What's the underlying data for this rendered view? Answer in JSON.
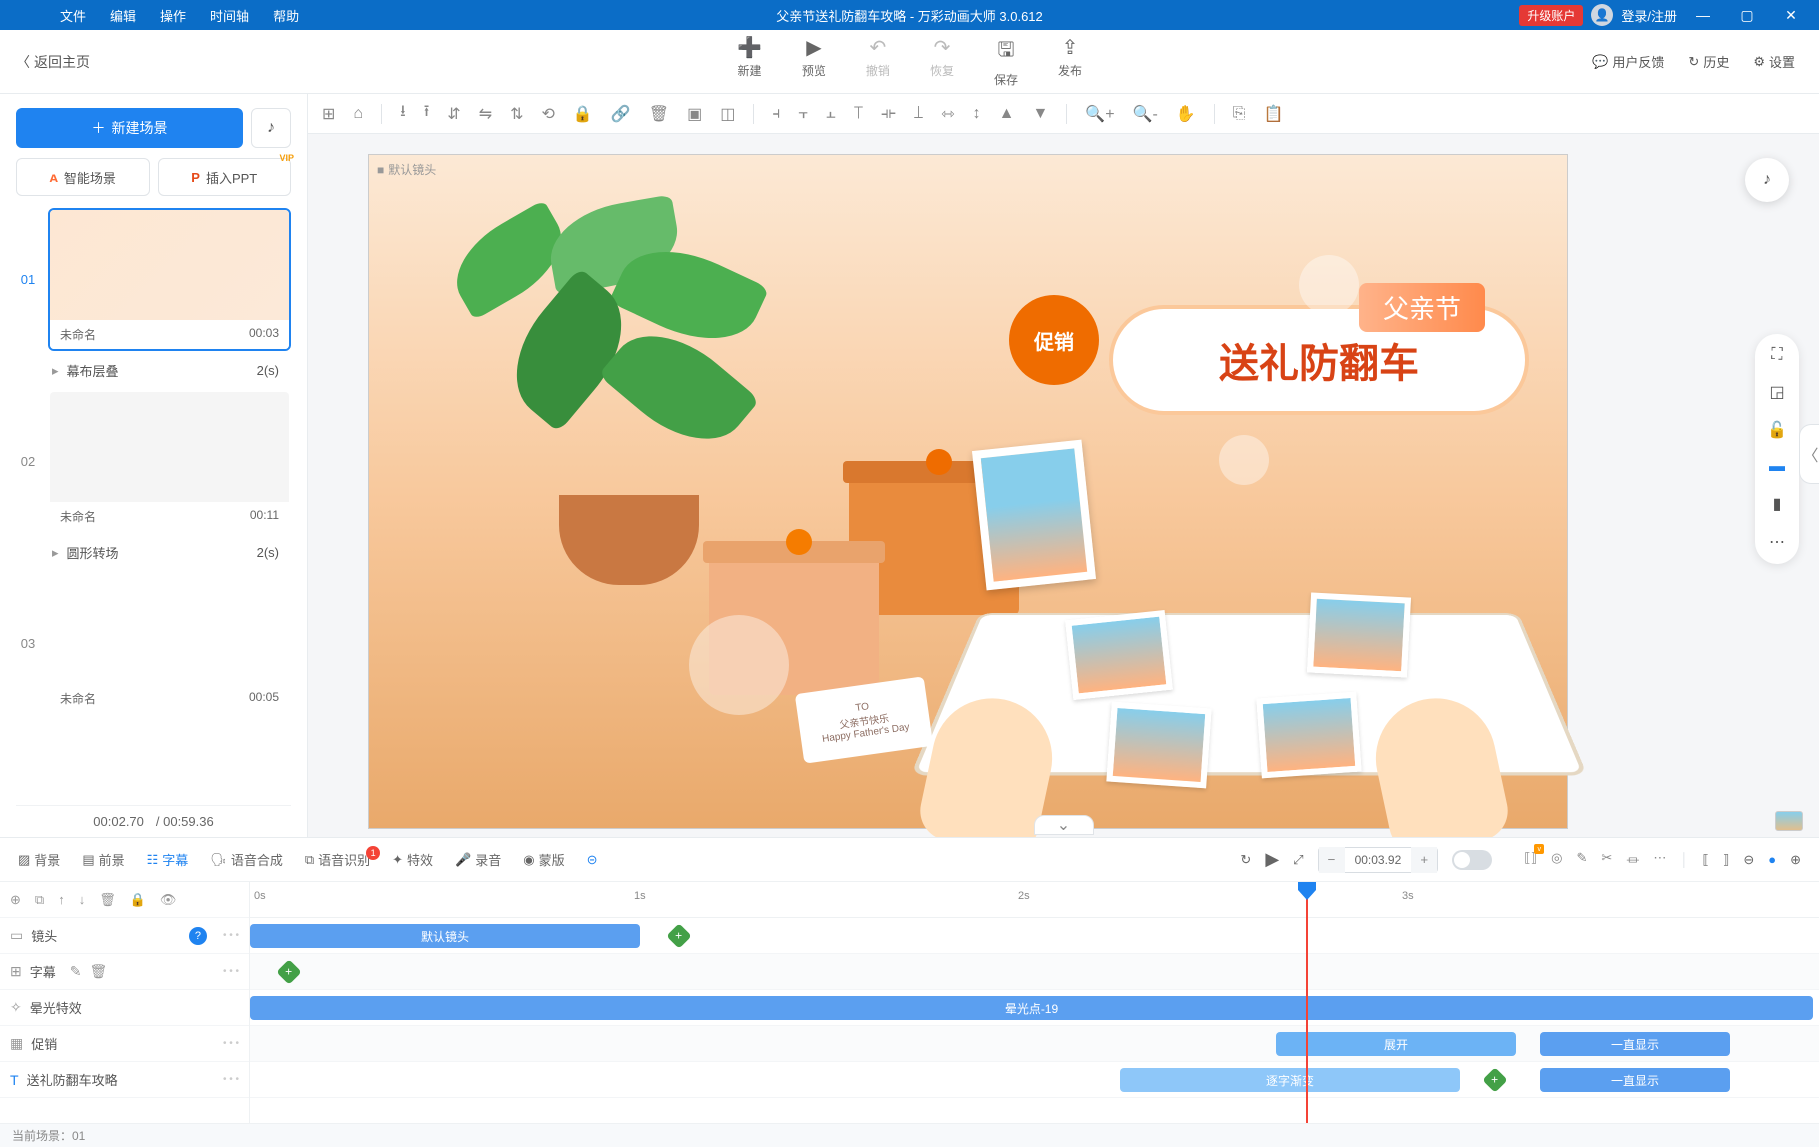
{
  "titlebar": {
    "menus": [
      "文件",
      "编辑",
      "操作",
      "时间轴",
      "帮助"
    ],
    "title": "父亲节送礼防翻车攻略 - 万彩动画大师 3.0.612",
    "upgrade": "升级账户",
    "login": "登录/注册"
  },
  "back": "返回主页",
  "toolbar": {
    "new": "新建",
    "preview": "预览",
    "undo": "撤销",
    "redo": "恢复",
    "save": "保存",
    "publish": "发布"
  },
  "toolbar_right": {
    "feedback": "用户反馈",
    "history": "历史",
    "settings": "设置"
  },
  "sidebar": {
    "newscene": "新建场景",
    "ai": "智能场景",
    "ppt": "插入PPT",
    "vip": "VIP",
    "scenes": [
      {
        "num": "01",
        "name": "未命名",
        "dur": "00:03",
        "trans": "幕布层叠",
        "tdur": "2(s)",
        "active": true
      },
      {
        "num": "02",
        "name": "未命名",
        "dur": "00:11",
        "trans": "圆形转场",
        "tdur": "2(s)"
      },
      {
        "num": "03",
        "name": "未命名",
        "dur": "00:05"
      }
    ],
    "cur": "00:02.70",
    "total": "/ 00:59.36"
  },
  "stage": {
    "cam": "默认镜头",
    "promo": "促销",
    "father": "父亲节",
    "bigtitle": "送礼防翻车",
    "card_to": "TO",
    "card_zh": "父亲节快乐",
    "card_en": "Happy Father's Day"
  },
  "tl": {
    "tabs": {
      "bg": "背景",
      "fg": "前景",
      "sub": "字幕",
      "tts": "语音合成",
      "asr": "语音识别",
      "badge": "1",
      "fx": "特效",
      "rec": "录音",
      "mask": "蒙版"
    },
    "time": "00:03.92",
    "ruler": [
      "0s",
      "1s",
      "2s",
      "3s"
    ],
    "rows": {
      "cam": "镜头",
      "sub": "字幕",
      "fx": "晕光特效",
      "promo": "促销",
      "title": "送礼防翻车攻略"
    },
    "clips": {
      "defcam": "默认镜头",
      "glow": "晕光点-19",
      "expand": "展开",
      "always": "一直显示",
      "grad": "逐字渐变"
    },
    "status": "当前场景：01"
  }
}
